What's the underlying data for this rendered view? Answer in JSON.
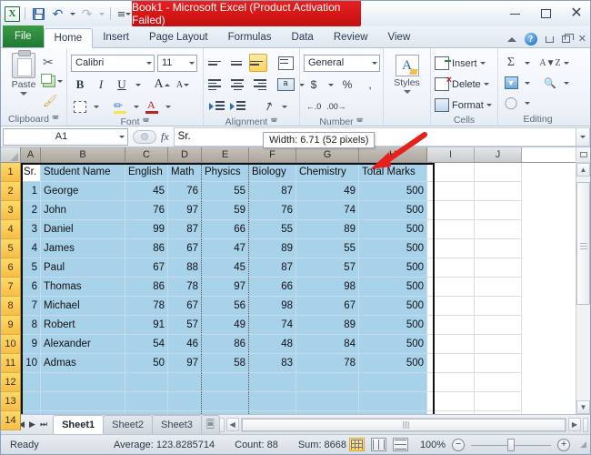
{
  "window": {
    "title": "Book1  -  Microsoft Excel (Product Activation Failed)",
    "minimize": "—",
    "restore": "❐",
    "close": "✕"
  },
  "qat": {
    "app_icon": "X",
    "save": "save-icon",
    "undo": "↺",
    "redo": "↻",
    "customize": "customize-qat-icon"
  },
  "ribbon": {
    "tabs": [
      {
        "label": "File",
        "active": false
      },
      {
        "label": "Home",
        "active": true
      },
      {
        "label": "Insert",
        "active": false
      },
      {
        "label": "Page Layout",
        "active": false
      },
      {
        "label": "Formulas",
        "active": false
      },
      {
        "label": "Data",
        "active": false
      },
      {
        "label": "Review",
        "active": false
      },
      {
        "label": "View",
        "active": false
      }
    ],
    "help": "?",
    "groups": {
      "clipboard": {
        "name": "Clipboard",
        "paste": "Paste",
        "cut": "✂",
        "copy": "copy-icon",
        "format_painter": "format-painter-icon"
      },
      "font": {
        "name": "Font",
        "font_family": "Calibri",
        "font_size": "11",
        "bold": "B",
        "italic": "I",
        "underline": "U",
        "grow": "A",
        "shrink": "A"
      },
      "alignment": {
        "name": "Alignment"
      },
      "number": {
        "name": "Number",
        "format": "General",
        "currency": "$",
        "percent": "%",
        "comma": ","
      },
      "styles": {
        "name": "Styles",
        "label": "Styles"
      },
      "cells": {
        "name": "Cells",
        "insert": "Insert",
        "delete": "Delete",
        "format": "Format"
      },
      "editing": {
        "name": "Editing",
        "autosum": "Σ",
        "fill": "fill-icon",
        "clear": "clear-icon",
        "sort_filter": "sort-filter-icon",
        "find_select": "find-select-icon"
      }
    }
  },
  "formula_bar": {
    "name_box": "A1",
    "fx": "fx",
    "value": "Sr."
  },
  "tooltip": {
    "text": "Width: 6.71 (52 pixels)"
  },
  "grid": {
    "column_headers": [
      "A",
      "B",
      "C",
      "D",
      "E",
      "F",
      "G",
      "H",
      "I",
      "J"
    ],
    "selected_columns": [
      "A",
      "B",
      "C",
      "D",
      "E",
      "F",
      "G",
      "H"
    ],
    "row_headers": [
      "1",
      "2",
      "3",
      "4",
      "5",
      "6",
      "7",
      "8",
      "9",
      "10",
      "11",
      "12",
      "13",
      "14"
    ],
    "headers": [
      "Sr.",
      "Student Name",
      "English",
      "Math",
      "Physics",
      "Biology",
      "Chemistry",
      "Total Marks"
    ],
    "rows": [
      [
        "1",
        "George",
        "45",
        "76",
        "55",
        "87",
        "49",
        "500"
      ],
      [
        "2",
        "John",
        "76",
        "97",
        "59",
        "76",
        "74",
        "500"
      ],
      [
        "3",
        "Daniel",
        "99",
        "87",
        "66",
        "55",
        "89",
        "500"
      ],
      [
        "4",
        "James",
        "86",
        "67",
        "47",
        "89",
        "55",
        "500"
      ],
      [
        "5",
        "Paul",
        "67",
        "88",
        "45",
        "87",
        "57",
        "500"
      ],
      [
        "6",
        "Thomas",
        "86",
        "78",
        "97",
        "66",
        "98",
        "500"
      ],
      [
        "7",
        "Michael",
        "78",
        "67",
        "56",
        "98",
        "67",
        "500"
      ],
      [
        "8",
        "Robert",
        "91",
        "57",
        "49",
        "74",
        "89",
        "500"
      ],
      [
        "9",
        "Alexander",
        "54",
        "46",
        "86",
        "48",
        "84",
        "500"
      ],
      [
        "10",
        "Admas",
        "50",
        "97",
        "58",
        "83",
        "78",
        "500"
      ]
    ],
    "active_cell": "A1"
  },
  "sheet_tabs": {
    "first": "⏮",
    "prev": "◀",
    "next": "▶",
    "last": "⏭",
    "tabs": [
      "Sheet1",
      "Sheet2",
      "Sheet3"
    ],
    "active": "Sheet1",
    "insert_sheet": "insert-worksheet-icon"
  },
  "status_bar": {
    "mode": "Ready",
    "average": "Average: 123.8285714",
    "count": "Count: 88",
    "sum": "Sum: 8668",
    "zoom": "100%",
    "zoom_out": "−",
    "zoom_in": "+",
    "views": [
      "normal-view",
      "page-layout-view",
      "page-break-view"
    ]
  },
  "colors": {
    "titlebar_red": "#d61515",
    "file_tab_green": "#2e8b40",
    "selection_blue": "#a8d1ea",
    "row_header_gold": "#ffd966",
    "annotation_red": "#e8201c"
  }
}
